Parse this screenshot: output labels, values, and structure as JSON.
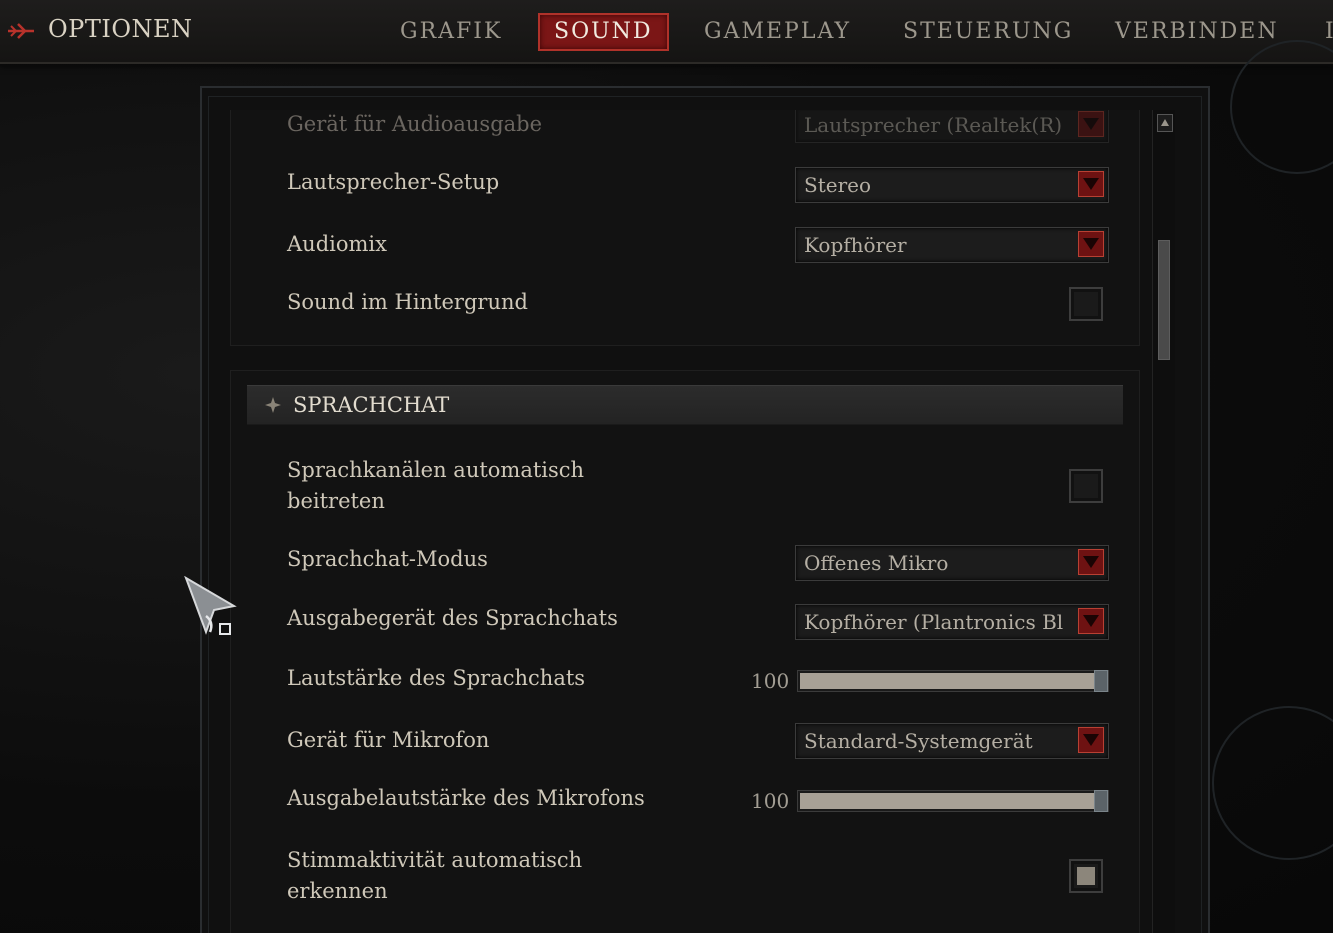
{
  "header": {
    "title": "OPTIONEN",
    "tabs": [
      {
        "label": "GRAFIK",
        "active": false
      },
      {
        "label": "SOUND",
        "active": true
      },
      {
        "label": "GAMEPLAY",
        "active": false
      },
      {
        "label": "STEUERUNG",
        "active": false
      },
      {
        "label": "VERBINDEN",
        "active": false
      }
    ]
  },
  "audio": {
    "output_device": {
      "label": "Gerät für Audioausgabe",
      "value": "Lautsprecher (Realtek(R) Audio)"
    },
    "speaker_setup": {
      "label": "Lautsprecher-Setup",
      "value": "Stereo"
    },
    "audiomix": {
      "label": "Audiomix",
      "value": "Kopfhörer"
    },
    "background_sound": {
      "label": "Sound im Hintergrund",
      "checked": false
    }
  },
  "voice_chat": {
    "header": "SPRACHCHAT",
    "auto_join": {
      "label_line1": "Sprachkanälen automatisch",
      "label_line2": "beitreten",
      "checked": false
    },
    "mode": {
      "label": "Sprachchat-Modus",
      "value": "Offenes Mikro"
    },
    "output_device": {
      "label": "Ausgabegerät des Sprachchats",
      "value": "Kopfhörer (Plantronics Blackwire)"
    },
    "volume": {
      "label": "Lautstärke des Sprachchats",
      "value": "100",
      "fraction": 1.0
    },
    "mic_device": {
      "label": "Gerät für Mikrofon",
      "value": "Standard-Systemgerät"
    },
    "mic_volume": {
      "label": "Ausgabelautstärke des Mikrofons",
      "value": "100",
      "fraction": 1.0
    },
    "voice_detect": {
      "label_line1": "Stimmaktivität automatisch",
      "label_line2": "erkennen",
      "checked": true
    }
  },
  "colors": {
    "accent_red": "#7b1616",
    "text": "#cfc8b9",
    "background": "#0d0d0d"
  }
}
